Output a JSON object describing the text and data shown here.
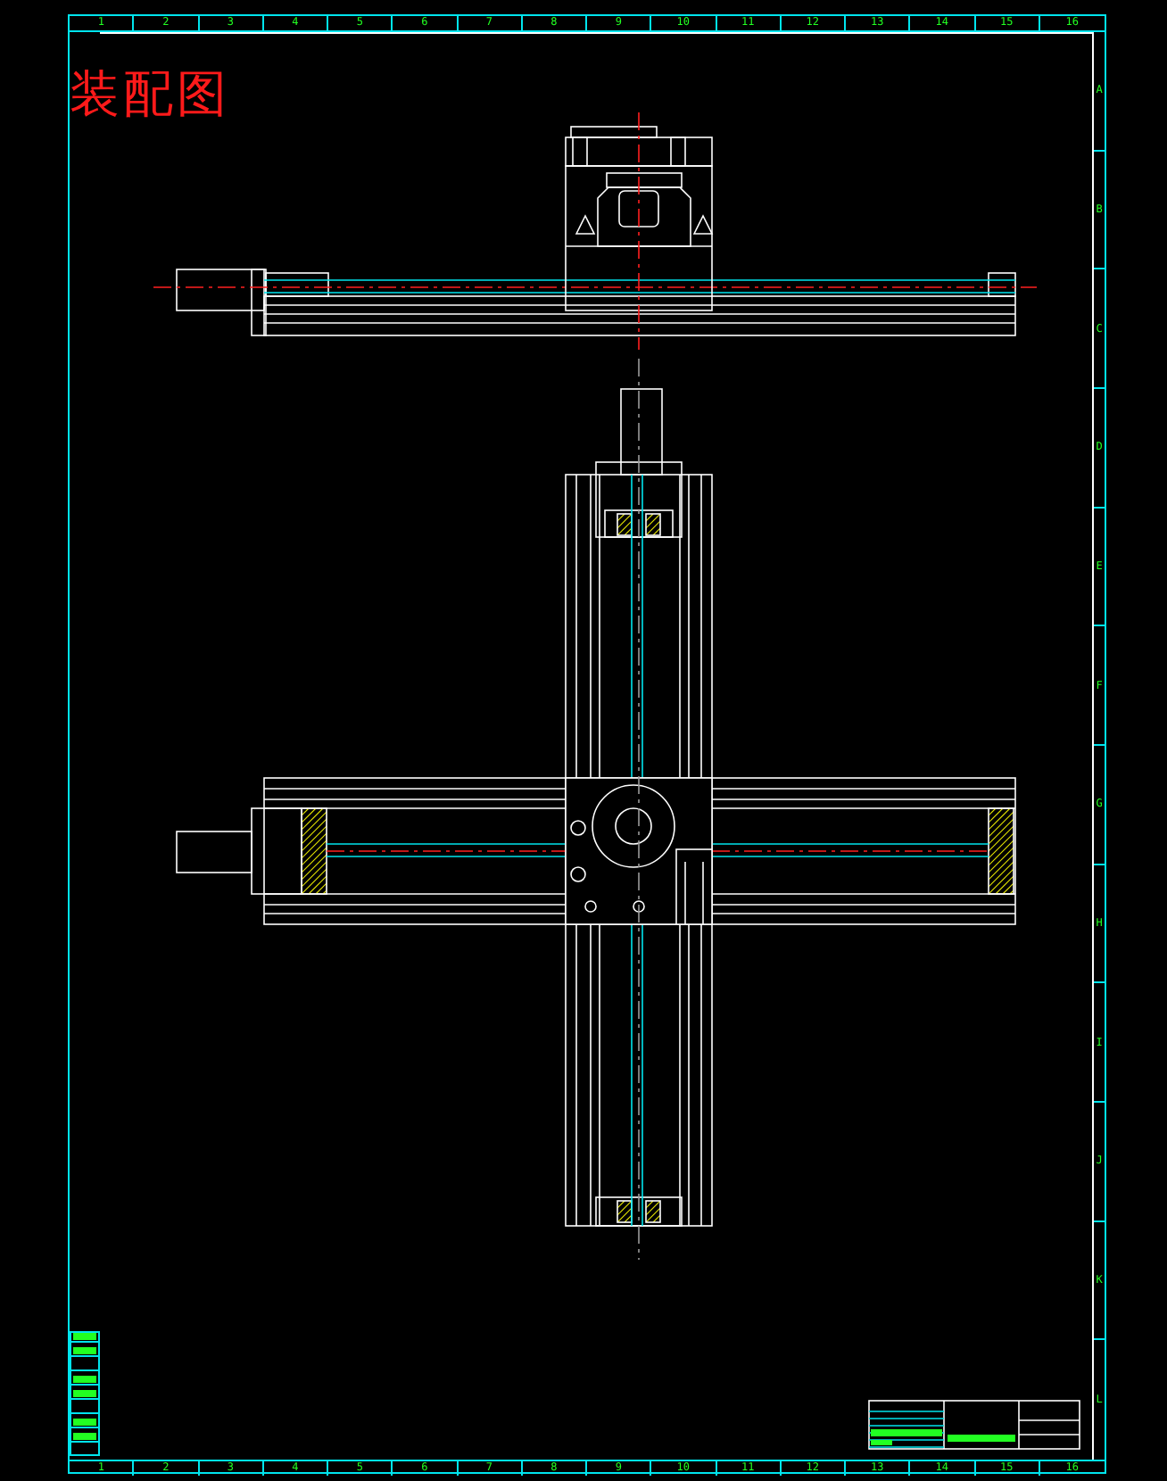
{
  "title": "装配图",
  "top_ruler": [
    "1",
    "2",
    "3",
    "4",
    "5",
    "6",
    "7",
    "8",
    "9",
    "10",
    "11",
    "12",
    "13",
    "14",
    "15",
    "16"
  ],
  "bottom_ruler": [
    "1",
    "2",
    "3",
    "4",
    "5",
    "6",
    "7",
    "8",
    "9",
    "10",
    "11",
    "12",
    "13",
    "14",
    "15",
    "16"
  ],
  "right_ruler": [
    "A",
    "B",
    "C",
    "D",
    "E",
    "F",
    "G",
    "H",
    "I",
    "J",
    "K",
    "L"
  ]
}
